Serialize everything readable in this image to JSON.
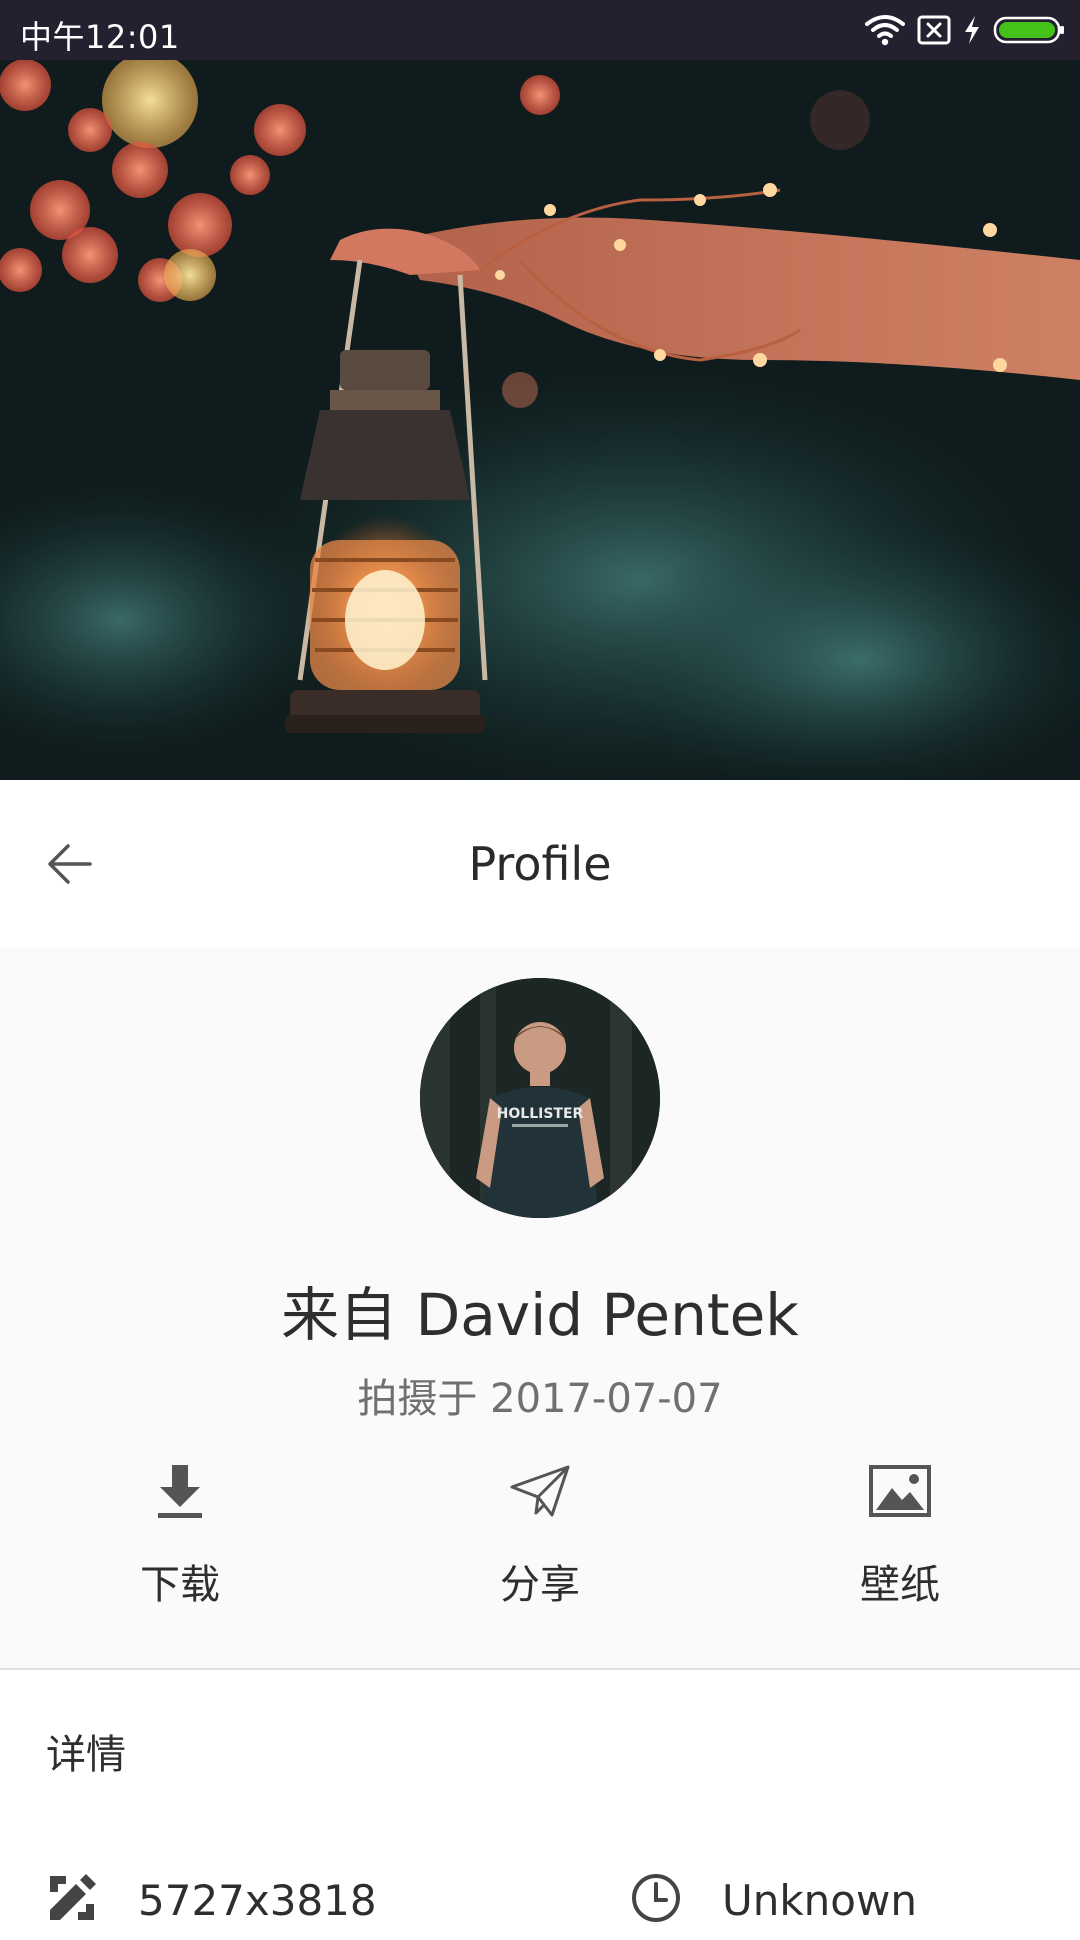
{
  "status_bar": {
    "time": "中午12:01",
    "icons": [
      "wifi-icon",
      "sim-blocked-icon",
      "charging-icon",
      "battery-icon"
    ],
    "battery_color": "#45c21a"
  },
  "hero": {
    "image": "lantern-photo"
  },
  "app_bar": {
    "title": "Profile",
    "back_icon": "arrow-left-icon"
  },
  "profile": {
    "author": "来自 David Pentek",
    "date": "拍摄于 2017-07-07",
    "avatar_shirt_text": "HOLLISTER",
    "actions": [
      {
        "label": "下载",
        "icon": "download-icon"
      },
      {
        "label": "分享",
        "icon": "send-icon"
      },
      {
        "label": "壁纸",
        "icon": "image-icon"
      }
    ]
  },
  "details": {
    "title": "详情",
    "items": [
      {
        "icon": "ruler-pencil-icon",
        "value": "5727x3818"
      },
      {
        "icon": "clock-icon",
        "value": "Unknown"
      }
    ]
  }
}
